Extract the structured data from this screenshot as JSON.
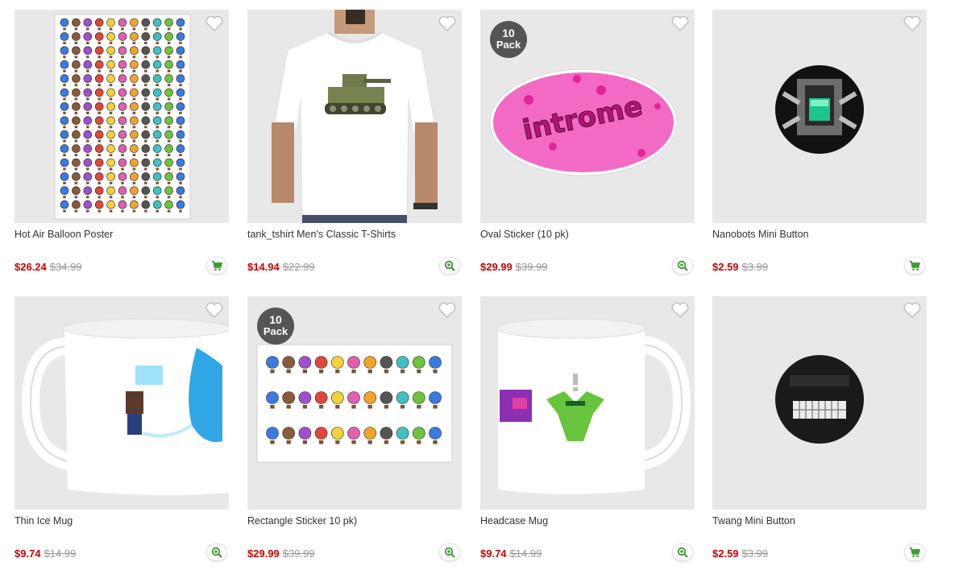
{
  "colors": {
    "sale": "#cc0000",
    "original": "#999999",
    "tile_bg": "#e8e8e9",
    "badge": "#555558",
    "icon_green": "#3c9a2e"
  },
  "products": [
    {
      "title": "Hot Air Balloon Poster",
      "sale_price": "$26.24",
      "original_price": "$34.99",
      "action_icon": "cart-icon",
      "pack_badge": null
    },
    {
      "title": "tank_tshirt Men's Classic T-Shirts",
      "sale_price": "$14.94",
      "original_price": "$22.99",
      "action_icon": "zoom-icon",
      "pack_badge": null
    },
    {
      "title": "Oval Sticker (10 pk)",
      "sale_price": "$29.99",
      "original_price": "$39.99",
      "action_icon": "zoom-icon",
      "pack_badge": {
        "count": "10",
        "label": "Pack"
      }
    },
    {
      "title": "Nanobots Mini Button",
      "sale_price": "$2.59",
      "original_price": "$3.99",
      "action_icon": "cart-icon",
      "pack_badge": null
    },
    {
      "title": "Thin Ice Mug",
      "sale_price": "$9.74",
      "original_price": "$14.99",
      "action_icon": "zoom-icon",
      "pack_badge": null
    },
    {
      "title": "Rectangle Sticker 10 pk)",
      "sale_price": "$29.99",
      "original_price": "$39.99",
      "action_icon": "zoom-icon",
      "pack_badge": {
        "count": "10",
        "label": "Pack"
      }
    },
    {
      "title": "Headcase Mug",
      "sale_price": "$9.74",
      "original_price": "$14.99",
      "action_icon": "zoom-icon",
      "pack_badge": null
    },
    {
      "title": "Twang Mini Button",
      "sale_price": "$2.59",
      "original_price": "$3.99",
      "action_icon": "cart-icon",
      "pack_badge": null
    }
  ],
  "sticker_logo_text": "introme"
}
